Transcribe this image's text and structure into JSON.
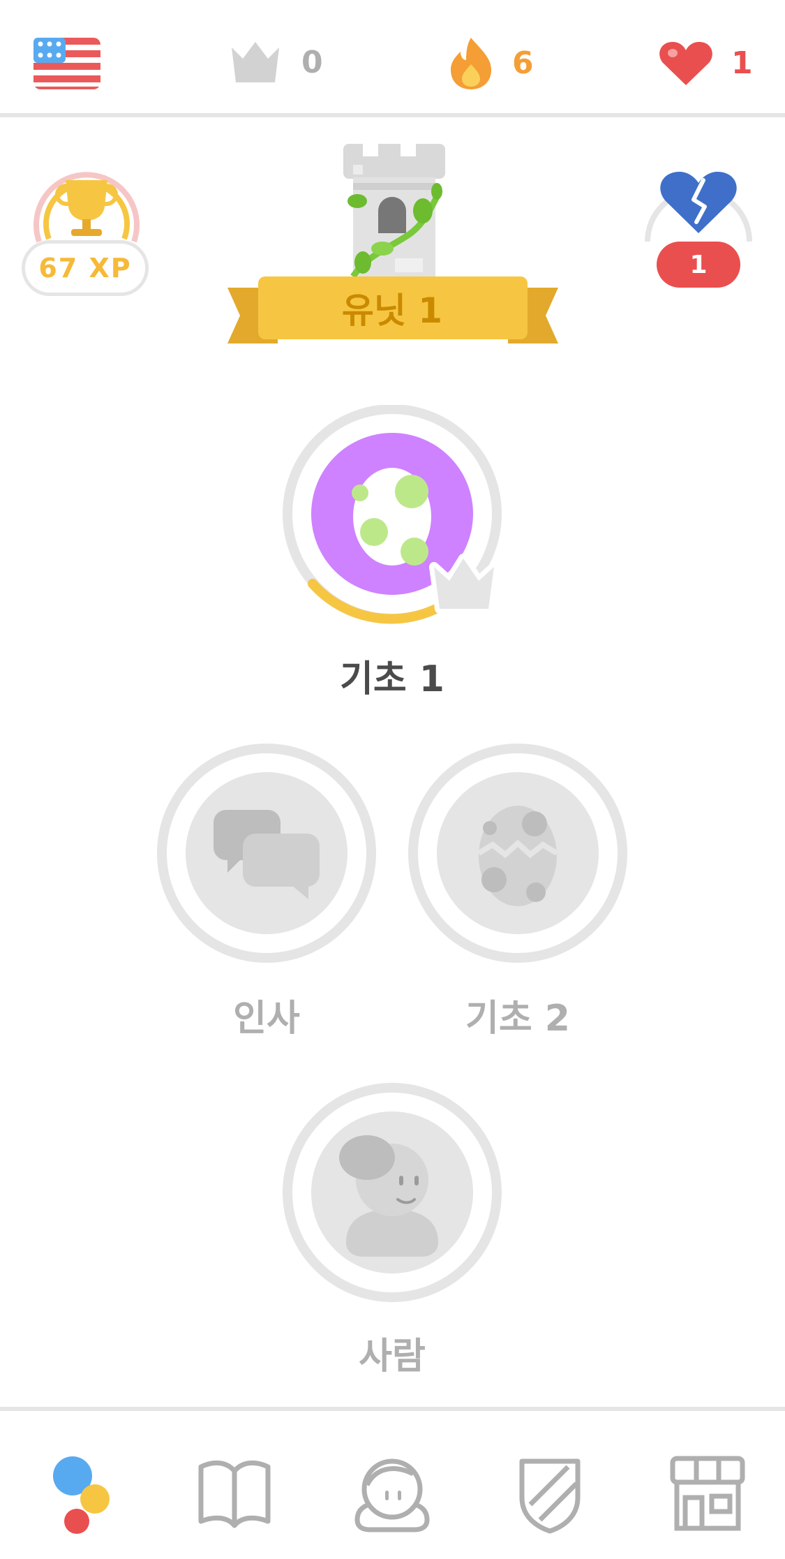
{
  "top_bar": {
    "language": "US English flag",
    "crowns": "0",
    "streak": "6",
    "hearts": "1"
  },
  "league": {
    "xp": "67 XP"
  },
  "health": {
    "count": "1"
  },
  "unit": {
    "title": "유닛 1"
  },
  "skills": [
    {
      "label": "기초 1",
      "state": "active"
    },
    {
      "label": "인사",
      "state": "locked"
    },
    {
      "label": "기초 2",
      "state": "locked"
    },
    {
      "label": "사람",
      "state": "locked"
    }
  ],
  "bottom_nav": [
    {
      "name": "learn",
      "icon": "learn-dots-icon"
    },
    {
      "name": "stories",
      "icon": "book-icon"
    },
    {
      "name": "profile",
      "icon": "profile-avatar-icon"
    },
    {
      "name": "leagues",
      "icon": "shield-icon"
    },
    {
      "name": "shop",
      "icon": "shop-icon"
    }
  ],
  "colors": {
    "accent_gold": "#f6c643",
    "streak_orange": "#f49e35",
    "heart_red": "#ea4f4f",
    "skill_purple": "#ce82ff",
    "locked_gray": "#e5e5e5",
    "label_dark": "#4b4b4b",
    "label_gray": "#afafaf"
  }
}
